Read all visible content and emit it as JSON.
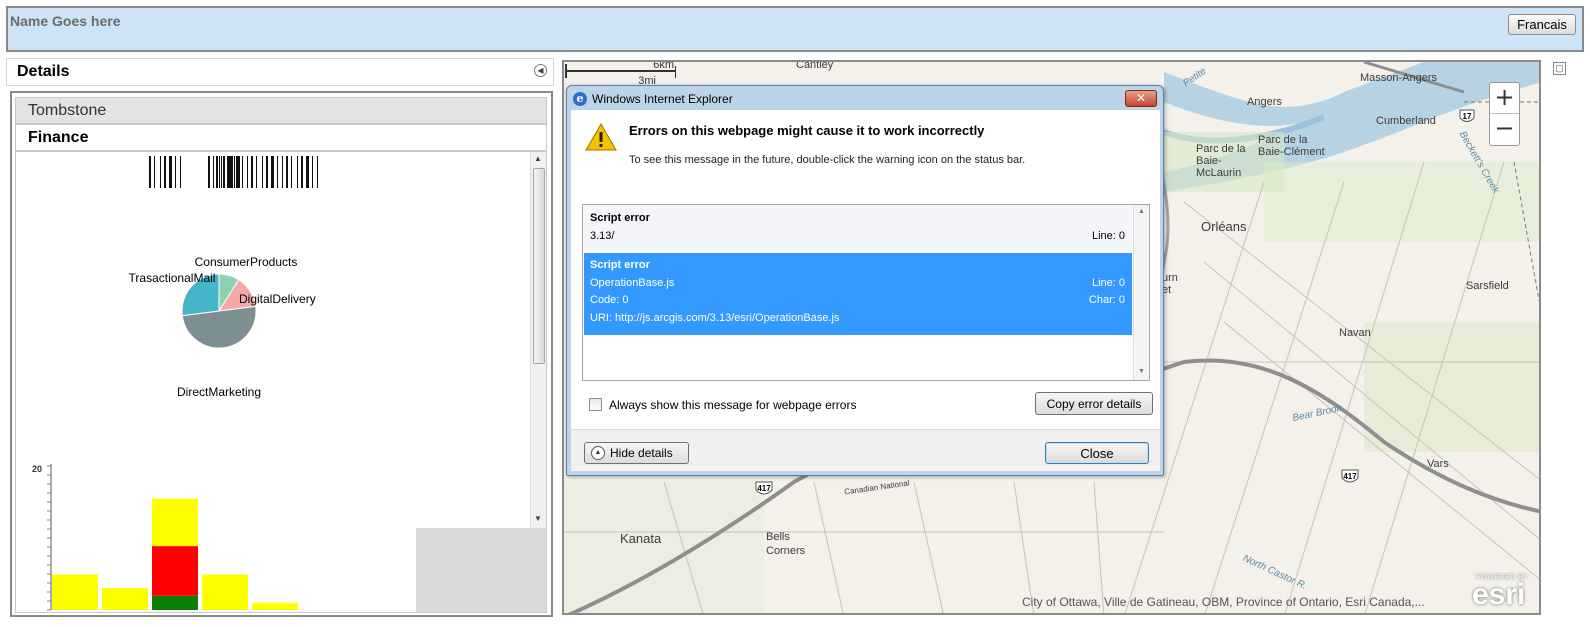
{
  "header": {
    "app_name": "Name Goes here",
    "language_button": "Francais"
  },
  "details": {
    "title": "Details",
    "sections": [
      {
        "label": "Tombstone"
      },
      {
        "label": "Finance"
      }
    ]
  },
  "chart_data": [
    {
      "type": "pie",
      "title": "",
      "categories": [
        "ConsumerProducts",
        "DigitalDelivery",
        "DirectMarketing",
        "TrasactionalMail"
      ],
      "values": [
        9,
        14,
        50,
        27
      ],
      "colors": [
        "#8fd0b4",
        "#f4a8a8",
        "#7e8f92",
        "#45b5c9"
      ]
    },
    {
      "type": "bar",
      "title": "",
      "categories": [
        "1",
        "2",
        "3",
        "4",
        "5"
      ],
      "series": [
        {
          "values": [
            0,
            0,
            2,
            0,
            0
          ],
          "color": "#0a7f0a"
        },
        {
          "values": [
            0,
            0,
            7,
            0,
            0
          ],
          "color": "#ff0000"
        },
        {
          "values": [
            5,
            3.1,
            6.7,
            5,
            1
          ],
          "color": "#ffff00"
        }
      ],
      "y_ticks": [
        "20"
      ],
      "ylim": [
        0,
        28
      ]
    }
  ],
  "map": {
    "labels": [
      "Cantley",
      "Masson-Angers",
      "Angers",
      "Cumberland",
      "Parc de la Baie-McLaurin",
      "Parc de la Baie-Clément",
      "Orléans",
      "Sarsfield",
      "Navan",
      "Vars",
      "Kanata",
      "Bells Corners",
      "Bear Brook",
      "North Castor R.",
      "Canadian National",
      "Beckett's Creek",
      "Petite",
      "urn",
      "et"
    ],
    "highway_shields": [
      "417",
      "417",
      "417",
      "17"
    ],
    "zoom_in": "+",
    "zoom_out": "−",
    "scale_km": "6km",
    "scale_mi": "3mi",
    "attribution": "City of Ottawa, Ville de Gatineau, OBM, Province of Ontario, Esri Canada,...",
    "logo_small": "POWERED BY",
    "logo_word": "esri"
  },
  "dialog": {
    "title": "Windows Internet Explorer",
    "close_x": "✕",
    "heading": "Errors on this webpage might cause it to work incorrectly",
    "subtext": "To see this message in the future, double-click the warning icon on the status bar.",
    "errors": [
      {
        "title": "Script error",
        "file": "3.13/",
        "line": "Line: 0"
      },
      {
        "title": "Script error",
        "file": "OperationBase.js",
        "line": "Line: 0",
        "code": "Code: 0",
        "char": "Char: 0",
        "uri": "URI: http://js.arcgis.com/3.13/esri/OperationBase.js"
      }
    ],
    "always_show_label": "Always show this message for webpage errors",
    "copy_button": "Copy error details",
    "hide_button": "Hide details",
    "close_button": "Close"
  }
}
